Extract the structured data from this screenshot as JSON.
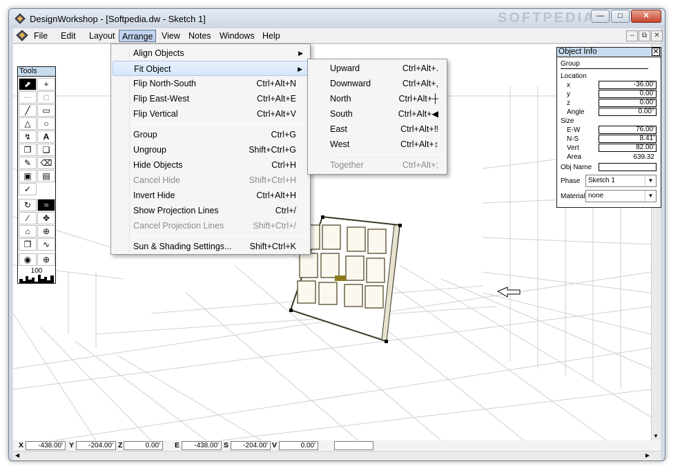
{
  "window": {
    "title": "DesignWorkshop - [Softpedia.dw - Sketch 1]",
    "watermark": "SOFTPEDIA"
  },
  "menubar": {
    "items": [
      "File",
      "Edit",
      "Layout",
      "Arrange",
      "View",
      "Notes",
      "Windows",
      "Help"
    ]
  },
  "arrange_menu": {
    "items": [
      {
        "label": "Align Objects",
        "shortcut": "",
        "submenu": true,
        "disabled": false
      },
      {
        "label": "Fit Object",
        "shortcut": "",
        "submenu": true,
        "disabled": false
      },
      {
        "label": "Flip North-South",
        "shortcut": "Ctrl+Alt+N",
        "disabled": false
      },
      {
        "label": "Flip East-West",
        "shortcut": "Ctrl+Alt+E",
        "disabled": false
      },
      {
        "label": "Flip Vertical",
        "shortcut": "Ctrl+Alt+V",
        "disabled": false
      },
      {
        "label": "Group",
        "shortcut": "Ctrl+G",
        "disabled": false
      },
      {
        "label": "Ungroup",
        "shortcut": "Shift+Ctrl+G",
        "disabled": false
      },
      {
        "label": "Hide Objects",
        "shortcut": "Ctrl+H",
        "disabled": false
      },
      {
        "label": "Cancel Hide",
        "shortcut": "Shift+Ctrl+H",
        "disabled": true
      },
      {
        "label": "Invert Hide",
        "shortcut": "Ctrl+Alt+H",
        "disabled": false
      },
      {
        "label": "Show Projection Lines",
        "shortcut": "Ctrl+/",
        "disabled": false
      },
      {
        "label": "Cancel Projection Lines",
        "shortcut": "Shift+Ctrl+/",
        "disabled": true
      },
      {
        "label": "Sun & Shading Settings...",
        "shortcut": "Shift+Ctrl+K",
        "disabled": false
      }
    ]
  },
  "fit_submenu": {
    "items": [
      {
        "label": "Upward",
        "shortcut": "Ctrl+Alt+.",
        "disabled": false
      },
      {
        "label": "Downward",
        "shortcut": "Ctrl+Alt+,",
        "disabled": false
      },
      {
        "label": "North",
        "shortcut": "Ctrl+Alt+┼",
        "disabled": false
      },
      {
        "label": "South",
        "shortcut": "Ctrl+Alt+◀",
        "disabled": false
      },
      {
        "label": "East",
        "shortcut": "Ctrl+Alt+‼",
        "disabled": false
      },
      {
        "label": "West",
        "shortcut": "Ctrl+Alt+↕",
        "disabled": false
      },
      {
        "label": "Together",
        "shortcut": "Ctrl+Alt+;",
        "disabled": true
      }
    ]
  },
  "tools": {
    "title": "Tools",
    "zoom": "100"
  },
  "object_info": {
    "title": "Object Info",
    "kind": "Group",
    "location_label": "Location",
    "x_label": "x",
    "x": "-36.00'",
    "y_label": "y",
    "y": "0.00'",
    "z_label": "z",
    "z": "0.00'",
    "angle_label": "Angle",
    "angle": "0.00°",
    "size_label": "Size",
    "ew_label": "E-W",
    "ew": "76.00'",
    "ns_label": "N-S",
    "ns": "8.41'",
    "vert_label": "Vert",
    "vert": "82.00'",
    "area_label": "Area",
    "area": "639.32",
    "objname_label": "Obj Name",
    "objname": "",
    "phase_label": "Phase",
    "phase": "Sketch 1",
    "material_label": "Material",
    "material": "none"
  },
  "coords": {
    "x_label": "X",
    "x": "-438.00'",
    "y_label": "Y",
    "y": "-204.00'",
    "z_label": "Z",
    "z": "0.00'",
    "e_label": "E",
    "e": "-438.00'",
    "s_label": "S",
    "s": "-204.00'",
    "v_label": "V",
    "v": "0.00'",
    "extra": ""
  },
  "colors": {
    "menu_highlight": "#d5e6fb",
    "palette_header": "#c8dcef",
    "door_frame": "#6b6146",
    "handle": "#8a7a1a"
  }
}
